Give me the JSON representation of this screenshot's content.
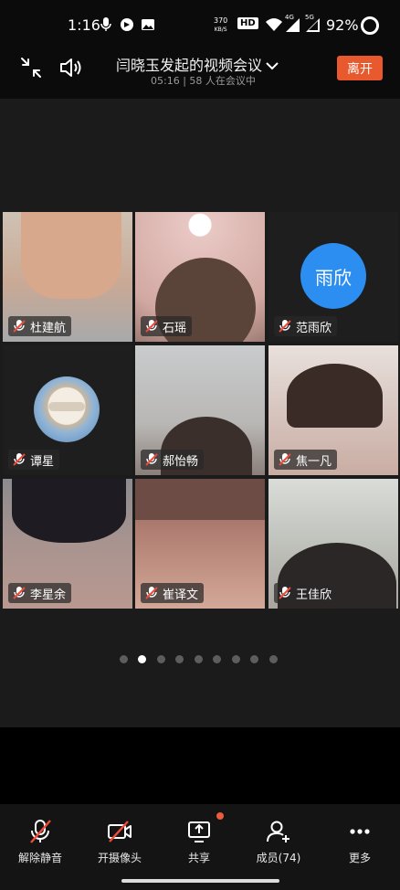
{
  "status_bar": {
    "time": "1:16",
    "net_speed_value": "370",
    "net_speed_unit": "KB/S",
    "hd_label": "HD",
    "network_4g": "4G",
    "network_5g": "5G",
    "battery": "92%"
  },
  "header": {
    "title": "闫晓玉发起的视频会议",
    "subtitle": "05:16 | 58 人在会议中",
    "leave_label": "离开"
  },
  "participants": [
    {
      "name": "杜建航",
      "muted": true,
      "tile_color": "#c9b8a6",
      "avatar_text": ""
    },
    {
      "name": "石瑶",
      "muted": true,
      "tile_color": "#d9b2ac",
      "avatar_text": ""
    },
    {
      "name": "范雨欣",
      "muted": true,
      "tile_color": "#1e1e1e",
      "avatar_text": "雨欣"
    },
    {
      "name": "谭星",
      "muted": true,
      "tile_color": "#1e1e1e",
      "avatar_text": ""
    },
    {
      "name": "郝怡畅",
      "muted": true,
      "tile_color": "#bfc0c3",
      "avatar_text": ""
    },
    {
      "name": "焦一凡",
      "muted": true,
      "tile_color": "#d7cbc6",
      "avatar_text": ""
    },
    {
      "name": "李星余",
      "muted": true,
      "tile_color": "#9b8f98",
      "avatar_text": ""
    },
    {
      "name": "崔译文",
      "muted": true,
      "tile_color": "#b07e72",
      "avatar_text": ""
    },
    {
      "name": "王佳欣",
      "muted": true,
      "tile_color": "#c4c7c1",
      "avatar_text": ""
    }
  ],
  "pager": {
    "total": 9,
    "active_index": 1
  },
  "toolbar": {
    "unmute_label": "解除静音",
    "camera_label": "开摄像头",
    "share_label": "共享",
    "members_label": "成员(74)",
    "more_label": "更多"
  },
  "colors": {
    "accent": "#e8592d",
    "avatar_blue": "#2b8ef0",
    "badge": "#ef5a3a"
  }
}
